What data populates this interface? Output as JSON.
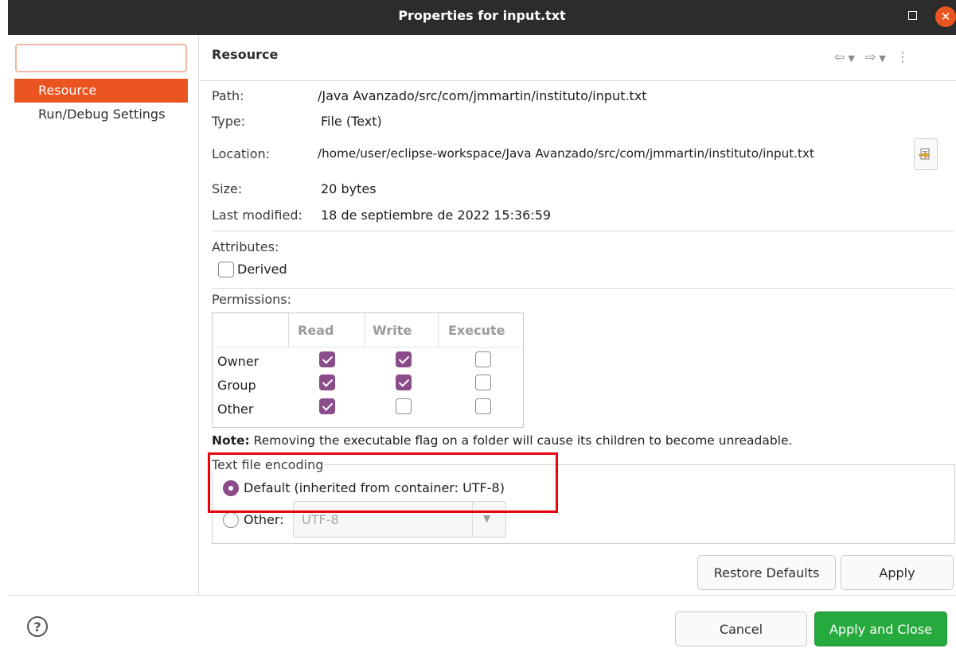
{
  "window": {
    "title": "Properties for input.txt"
  },
  "sidebar": {
    "filter_placeholder": "",
    "items": [
      {
        "label": "Resource",
        "selected": true
      },
      {
        "label": "Run/Debug Settings",
        "selected": false
      }
    ]
  },
  "page": {
    "title": "Resource",
    "fields": {
      "path_label": "Path:",
      "path_value": "/Java Avanzado/src/com/jmmartin/instituto/input.txt",
      "type_label": "Type:",
      "type_value": "File  (Text)",
      "location_label": "Location:",
      "location_value": "/home/user/eclipse-workspace/Java Avanzado/src/com/jmmartin/instituto/input.txt",
      "size_label": "Size:",
      "size_value": "20  bytes",
      "modified_label": "Last modified:",
      "modified_value": "18 de septiembre de 2022 15:36:59"
    },
    "attributes": {
      "label": "Attributes:",
      "derived_label": "Derived",
      "derived_checked": false
    },
    "permissions": {
      "label": "Permissions:",
      "columns": [
        "Read",
        "Write",
        "Execute"
      ],
      "rows": [
        {
          "name": "Owner",
          "read": true,
          "write": true,
          "execute": false
        },
        {
          "name": "Group",
          "read": true,
          "write": true,
          "execute": false
        },
        {
          "name": "Other",
          "read": true,
          "write": false,
          "execute": false
        }
      ]
    },
    "note": {
      "bold": "Note:",
      "text": " Removing the executable flag on a folder will cause its children to become unreadable."
    },
    "encoding": {
      "label": "Text file encoding",
      "default_label": "Default (inherited from container: UTF-8)",
      "default_selected": true,
      "other_label": "Other:",
      "other_value": "UTF-8"
    }
  },
  "buttons": {
    "restore_defaults": "Restore Defaults",
    "apply": "Apply",
    "cancel": "Cancel",
    "apply_and_close": "Apply and Close"
  },
  "icons": {
    "help": "?",
    "close": "✕"
  },
  "colors": {
    "accent": "#e95420",
    "check": "#8a4c8a",
    "primary_button": "#26a93d",
    "highlight": "#e8000c"
  }
}
